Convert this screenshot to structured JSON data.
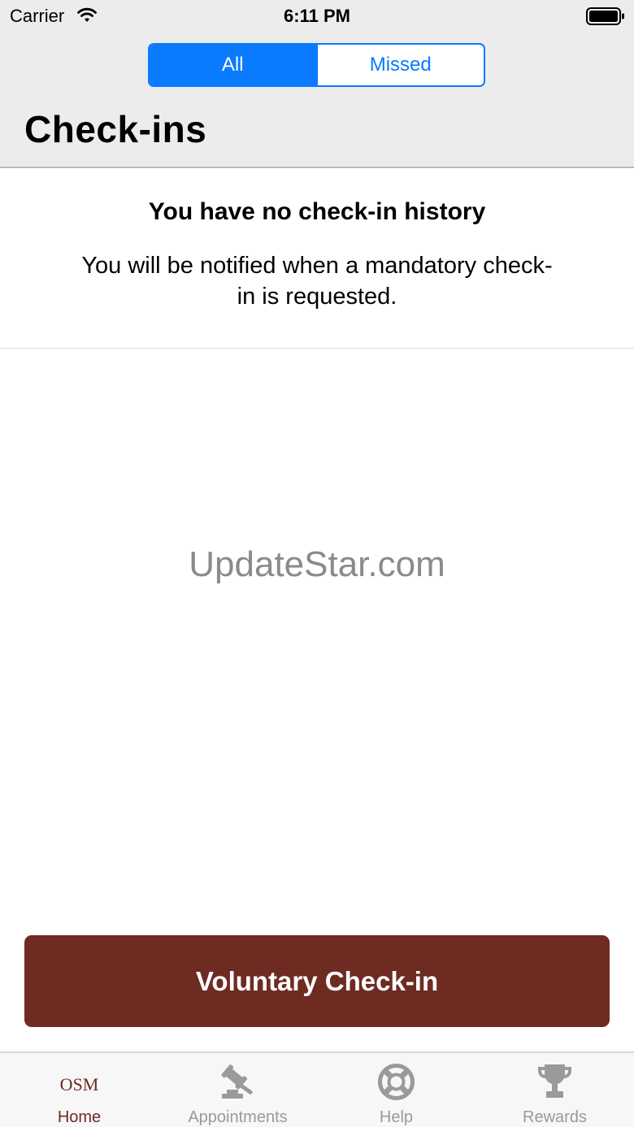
{
  "status_bar": {
    "carrier": "Carrier",
    "time": "6:11 PM",
    "icons": [
      "wifi-icon",
      "battery-icon"
    ]
  },
  "segmented_control": {
    "segments": [
      {
        "label": "All",
        "selected": true
      },
      {
        "label": "Missed",
        "selected": false
      }
    ],
    "accent_color": "#0a7aff"
  },
  "page": {
    "title": "Check-ins"
  },
  "empty_state": {
    "title": "You have no check-in history",
    "message": "You will be notified when a mandatory check-in is requested."
  },
  "watermark": "UpdateStar.com",
  "voluntary_button": {
    "label": "Voluntary Check-in",
    "color": "#6e2b22"
  },
  "tab_bar": {
    "tabs": [
      {
        "label": "Home",
        "logo_text": "OSM",
        "icon": "osm-logo",
        "active": true
      },
      {
        "label": "Appointments",
        "icon": "gavel-icon",
        "active": false
      },
      {
        "label": "Help",
        "icon": "lifebuoy-icon",
        "active": false
      },
      {
        "label": "Rewards",
        "icon": "trophy-icon",
        "active": false
      }
    ],
    "active_color": "#6e2b22",
    "inactive_color": "#9a9a9a"
  }
}
